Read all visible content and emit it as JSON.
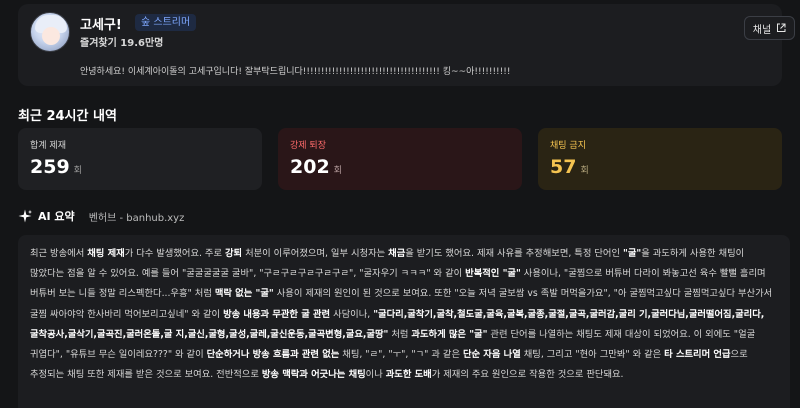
{
  "profile": {
    "name": "고세구!",
    "badge": "숲 스트리머",
    "followers": "즐겨찾기 19.6만명",
    "bio": "안녕하세요! 이세계아이돌의 고세구입니다! 잘부탁드립니다!!!!!!!!!!!!!!!!!!!!!!!!!!!!!!!!!!!!!! 킹~~아!!!!!!!!!!",
    "channel_button": "채널"
  },
  "stats": {
    "section_title": "최근 24시간 내역",
    "total": {
      "label": "합계 제재",
      "value": "259",
      "unit": "회"
    },
    "kick": {
      "label": "강제 퇴장",
      "value": "202",
      "unit": "회"
    },
    "chat_ban": {
      "label": "채팅 금지",
      "value": "57",
      "unit": "회"
    }
  },
  "ai_summary": {
    "title": "AI 요약",
    "source": "벤허브 - banhub.xyz",
    "segments": [
      {
        "t": "최근 방송에서 "
      },
      {
        "t": "채팅 제재",
        "b": true
      },
      {
        "t": "가 다수 발생했어요. 주로 "
      },
      {
        "t": "강퇴",
        "b": true
      },
      {
        "t": " 처분이 이루어졌으며, 일부 시청자는 "
      },
      {
        "t": "채금",
        "b": true
      },
      {
        "t": "을 받기도 했어요.  제재 사유를 추정해보면, 특정 단어인 "
      },
      {
        "t": "\"굴\"",
        "b": true
      },
      {
        "t": "을 과도하게 사용한 채팅이 많았다는 점을 알 수 있어요. 예를 들어 \"굴굴굴굴굴 굴바\", \"구ㄹ구ㄹ구ㄹ구ㄹ구ㄹ\", \"굴자우기 ㅋㅋㅋ\" 와 같이 "
      },
      {
        "t": "반복적인 \"굴\"",
        "b": true
      },
      {
        "t": " 사용이나, \"굴찜으로 버튜버 다라이 봐놓고선  육수 빨뻘 흘리며 버튜버 보는 니들 정말 리스펙한다...우흥\" 처럼 "
      },
      {
        "t": "맥락 없는 \"굴\"",
        "b": true
      },
      {
        "t": " 사용이 제재의 원인이 된 것으로 보여요. 또한 \"오늘 저녁 굴보쌈 vs 족발 머먹을가요\", \"아 굴찜먹고싶다 굴찜먹고싶다 부산가서 굴찜 싸아야악 한사바리 먹어보리고싶네\" 와 같이 "
      },
      {
        "t": "방송 내용과 무관한 굴 관련",
        "b": true
      },
      {
        "t": " 사담이나, "
      },
      {
        "t": "\"굴다리,굴착기,굴착,철도굴,굴육,굴복,굴종,굴절,굴곡,굴러감,굴리 기,굴러다님,굴러떨어짐,굴리다,굴착공사,굴삭기,굴곡진,굴러온돌,굴 지,굴신,굴형,굴성,굴레,굴신운동,굴곡변형,굴요,굴땅\"",
        "b": true
      },
      {
        "t": " 처럼 "
      },
      {
        "t": "과도하게 많은 \"굴\"",
        "b": true
      },
      {
        "t": " 관련 단어를 나열하는 채팅도 제재 대상이 되었어요. 이 외에도 \"얼굴 귀엽다\", \"유튜브 무슨 일이레요???\" 와 같이 "
      },
      {
        "t": "단순하거나 방송 흐름과 관련 없는",
        "b": true
      },
      {
        "t": " 채팅, \"ㄹ\", \"ㅜ\", \"ㄱ\" 과 같은 "
      },
      {
        "t": "단순 자음 나열",
        "b": true
      },
      {
        "t": " 채팅, 그리고 \"현아 그만봐\" 와 같은 "
      },
      {
        "t": "타 스트리머 언급",
        "b": true
      },
      {
        "t": "으로 추정되는 채팅 또한 제재를 받은 것으로 보여요. 전반적으로 "
      },
      {
        "t": "방송 맥락과 어긋나는 채팅",
        "b": true
      },
      {
        "t": "이나 "
      },
      {
        "t": "과도한 도배",
        "b": true
      },
      {
        "t": "가 제재의 주요 원인으로 작용한 것으로 판단돼요."
      }
    ]
  },
  "icons": {
    "external_link": "external-link-icon",
    "ai_sparkle": "sparkle-icon"
  },
  "colors": {
    "background": "#141517",
    "card": "#1c1d20",
    "kick_accent": "#ff6b6b",
    "ban_accent": "#f5c451",
    "badge_text": "#7fa8ff"
  }
}
